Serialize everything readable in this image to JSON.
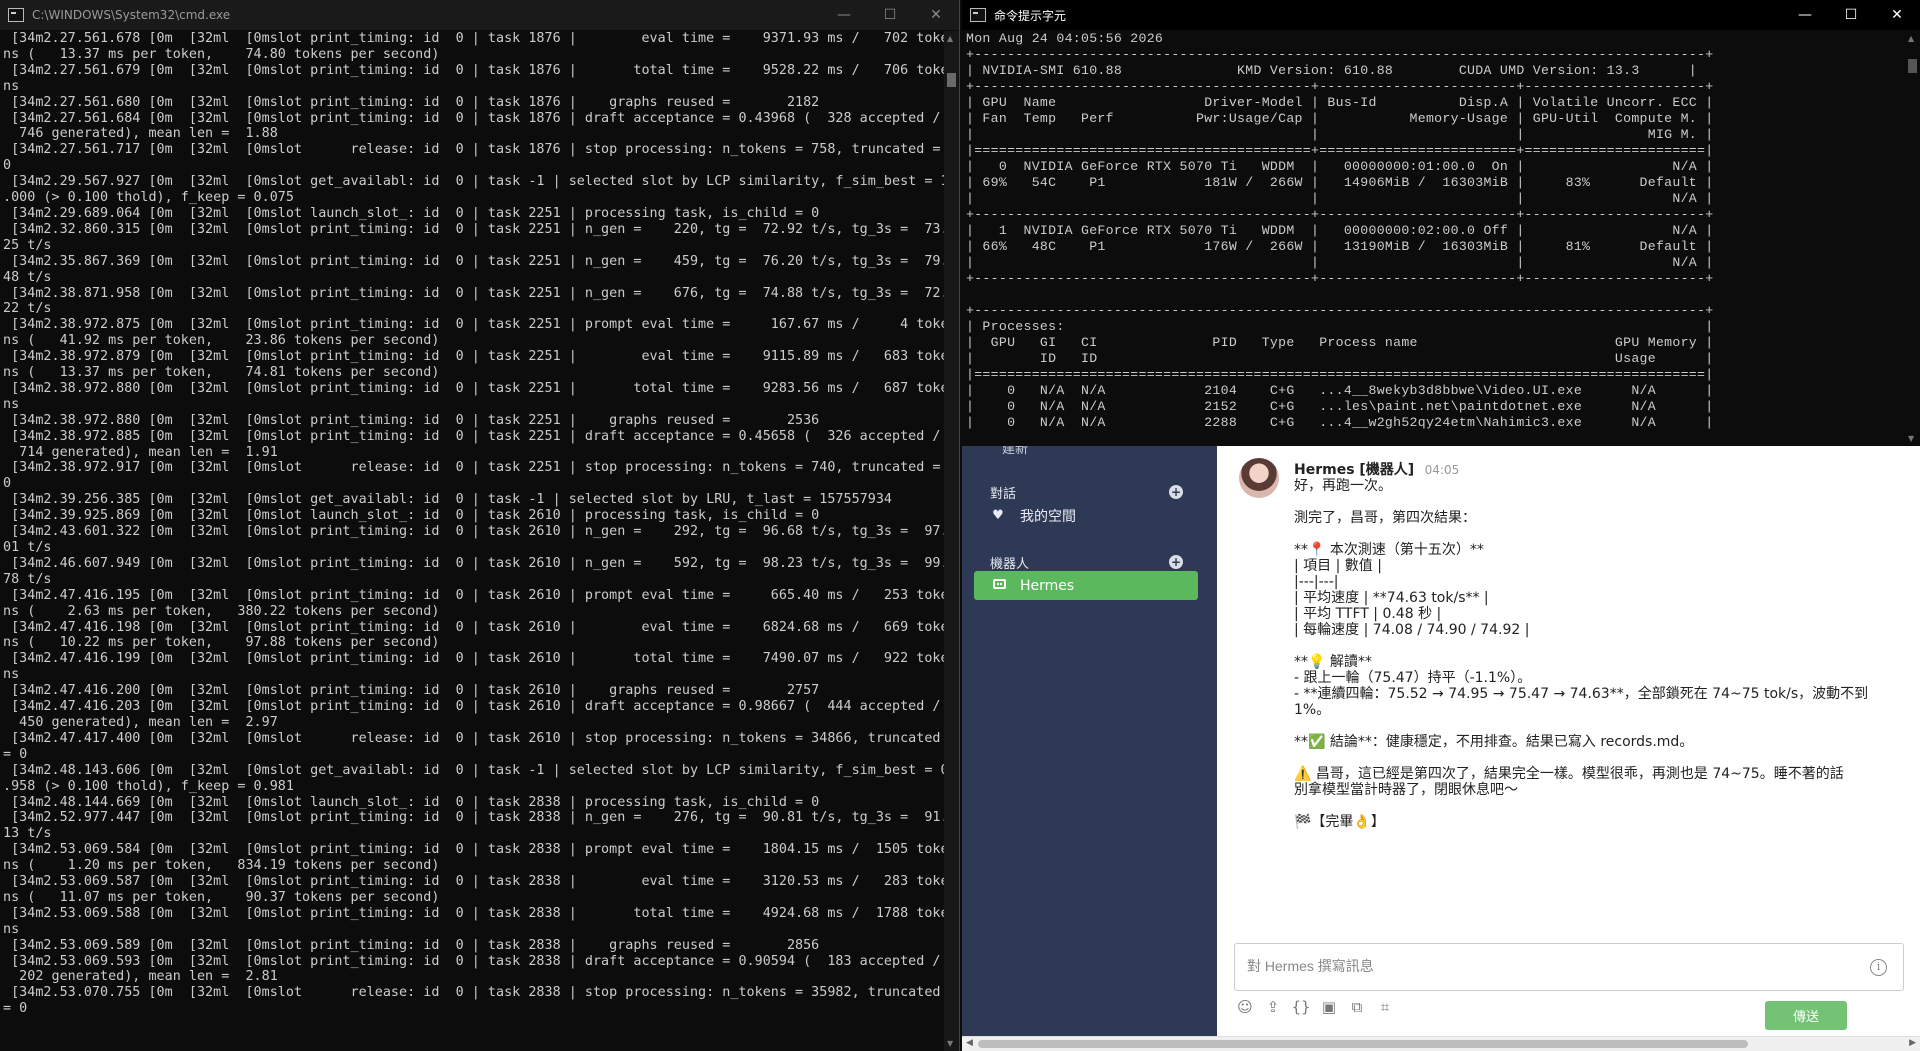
{
  "left_window": {
    "title": "C:\\WINDOWS\\System32\\cmd.exe",
    "lines": [
      " [34m2.27.561.678 [0m  [32ml  [0mslot print_timing: id  0 | task 1876 |        eval time =    9371.93 ms /   702 toke",
      "ns (   13.37 ms per token,    74.80 tokens per second)",
      " [34m2.27.561.679 [0m  [32ml  [0mslot print_timing: id  0 | task 1876 |       total time =    9528.22 ms /   706 toke",
      "ns",
      " [34m2.27.561.680 [0m  [32ml  [0mslot print_timing: id  0 | task 1876 |    graphs reused =       2182",
      " [34m2.27.561.684 [0m  [32ml  [0mslot print_timing: id  0 | task 1876 | draft acceptance = 0.43968 (  328 accepted /",
      "  746 generated), mean len =  1.88",
      " [34m2.27.561.717 [0m  [32ml  [0mslot      release: id  0 | task 1876 | stop processing: n_tokens = 758, truncated =",
      "0",
      " [34m2.29.567.927 [0m  [32ml  [0mslot get_availabl: id  0 | task -1 | selected slot by LCP similarity, f_sim_best = 1",
      ".000 (> 0.100 thold), f_keep = 0.075",
      " [34m2.29.689.064 [0m  [32ml  [0mslot launch_slot_: id  0 | task 2251 | processing task, is_child = 0",
      " [34m2.32.860.315 [0m  [32ml  [0mslot print_timing: id  0 | task 2251 | n_gen =    220, tg =  72.92 t/s, tg_3s =  73.",
      "25 t/s",
      " [34m2.35.867.369 [0m  [32ml  [0mslot print_timing: id  0 | task 2251 | n_gen =    459, tg =  76.20 t/s, tg_3s =  79.",
      "48 t/s",
      " [34m2.38.871.958 [0m  [32ml  [0mslot print_timing: id  0 | task 2251 | n_gen =    676, tg =  74.88 t/s, tg_3s =  72.",
      "22 t/s",
      " [34m2.38.972.875 [0m  [32ml  [0mslot print_timing: id  0 | task 2251 | prompt eval time =     167.67 ms /     4 toke",
      "ns (   41.92 ms per token,    23.86 tokens per second)",
      " [34m2.38.972.879 [0m  [32ml  [0mslot print_timing: id  0 | task 2251 |        eval time =    9115.89 ms /   683 toke",
      "ns (   13.37 ms per token,    74.81 tokens per second)",
      " [34m2.38.972.880 [0m  [32ml  [0mslot print_timing: id  0 | task 2251 |       total time =    9283.56 ms /   687 toke",
      "ns",
      " [34m2.38.972.880 [0m  [32ml  [0mslot print_timing: id  0 | task 2251 |    graphs reused =       2536",
      " [34m2.38.972.885 [0m  [32ml  [0mslot print_timing: id  0 | task 2251 | draft acceptance = 0.45658 (  326 accepted /",
      "  714 generated), mean len =  1.91",
      " [34m2.38.972.917 [0m  [32ml  [0mslot      release: id  0 | task 2251 | stop processing: n_tokens = 740, truncated =",
      "0",
      " [34m2.39.256.385 [0m  [32ml  [0mslot get_availabl: id  0 | task -1 | selected slot by LRU, t_last = 157557934",
      " [34m2.39.925.869 [0m  [32ml  [0mslot launch_slot_: id  0 | task 2610 | processing task, is_child = 0",
      " [34m2.43.601.322 [0m  [32ml  [0mslot print_timing: id  0 | task 2610 | n_gen =    292, tg =  96.68 t/s, tg_3s =  97.",
      "01 t/s",
      " [34m2.46.607.949 [0m  [32ml  [0mslot print_timing: id  0 | task 2610 | n_gen =    592, tg =  98.23 t/s, tg_3s =  99.",
      "78 t/s",
      " [34m2.47.416.195 [0m  [32ml  [0mslot print_timing: id  0 | task 2610 | prompt eval time =     665.40 ms /   253 toke",
      "ns (    2.63 ms per token,   380.22 tokens per second)",
      " [34m2.47.416.198 [0m  [32ml  [0mslot print_timing: id  0 | task 2610 |        eval time =    6824.68 ms /   669 toke",
      "ns (   10.22 ms per token,    97.88 tokens per second)",
      " [34m2.47.416.199 [0m  [32ml  [0mslot print_timing: id  0 | task 2610 |       total time =    7490.07 ms /   922 toke",
      "ns",
      " [34m2.47.416.200 [0m  [32ml  [0mslot print_timing: id  0 | task 2610 |    graphs reused =       2757",
      " [34m2.47.416.203 [0m  [32ml  [0mslot print_timing: id  0 | task 2610 | draft acceptance = 0.98667 (  444 accepted /",
      "  450 generated), mean len =  2.97",
      " [34m2.47.417.400 [0m  [32ml  [0mslot      release: id  0 | task 2610 | stop processing: n_tokens = 34866, truncated",
      "= 0",
      " [34m2.48.143.606 [0m  [32ml  [0mslot get_availabl: id  0 | task -1 | selected slot by LCP similarity, f_sim_best = 0",
      ".958 (> 0.100 thold), f_keep = 0.981",
      " [34m2.48.144.669 [0m  [32ml  [0mslot launch_slot_: id  0 | task 2838 | processing task, is_child = 0",
      " [34m2.52.977.447 [0m  [32ml  [0mslot print_timing: id  0 | task 2838 | n_gen =    276, tg =  90.81 t/s, tg_3s =  91.",
      "13 t/s",
      " [34m2.53.069.584 [0m  [32ml  [0mslot print_timing: id  0 | task 2838 | prompt eval time =    1804.15 ms /  1505 toke",
      "ns (    1.20 ms per token,   834.19 tokens per second)",
      " [34m2.53.069.587 [0m  [32ml  [0mslot print_timing: id  0 | task 2838 |        eval time =    3120.53 ms /   283 toke",
      "ns (   11.07 ms per token,    90.37 tokens per second)",
      " [34m2.53.069.588 [0m  [32ml  [0mslot print_timing: id  0 | task 2838 |       total time =    4924.68 ms /  1788 toke",
      "ns",
      " [34m2.53.069.589 [0m  [32ml  [0mslot print_timing: id  0 | task 2838 |    graphs reused =       2856",
      " [34m2.53.069.593 [0m  [32ml  [0mslot print_timing: id  0 | task 2838 | draft acceptance = 0.90594 (  183 accepted /",
      "  202 generated), mean len =  2.81",
      " [34m2.53.070.755 [0m  [32ml  [0mslot      release: id  0 | task 2838 | stop processing: n_tokens = 35982, truncated",
      "= 0"
    ]
  },
  "right_window": {
    "title": "命令提示字元",
    "lines": [
      "Mon Aug 24 04:05:56 2026",
      "+-----------------------------------------------------------------------------------------+",
      "| NVIDIA-SMI 610.88              KMD Version: 610.88        CUDA UMD Version: 13.3      |",
      "+-----------------------------------------+------------------------+----------------------+",
      "| GPU  Name                  Driver-Model | Bus-Id          Disp.A | Volatile Uncorr. ECC |",
      "| Fan  Temp   Perf          Pwr:Usage/Cap |           Memory-Usage | GPU-Util  Compute M. |",
      "|                                         |                        |               MIG M. |",
      "|=========================================+========================+======================|",
      "|   0  NVIDIA GeForce RTX 5070 Ti   WDDM  |   00000000:01:00.0  On |                  N/A |",
      "| 69%   54C    P1            181W /  266W |   14906MiB /  16303MiB |     83%      Default |",
      "|                                         |                        |                  N/A |",
      "+-----------------------------------------+------------------------+----------------------+",
      "|   1  NVIDIA GeForce RTX 5070 Ti   WDDM  |   00000000:02:00.0 Off |                  N/A |",
      "| 66%   48C    P1            176W /  266W |   13190MiB /  16303MiB |     81%      Default |",
      "|                                         |                        |                  N/A |",
      "+-----------------------------------------+------------------------+----------------------+",
      "",
      "+-----------------------------------------------------------------------------------------+",
      "| Processes:                                                                              |",
      "|  GPU   GI   CI              PID   Type   Process name                        GPU Memory |",
      "|        ID   ID                                                               Usage      |",
      "|=========================================================================================|",
      "|    0   N/A  N/A            2104    C+G   ...4__8wekyb3d8bbwe\\Video.UI.exe      N/A      |",
      "|    0   N/A  N/A            2152    C+G   ...les\\paint.net\\paintdotnet.exe      N/A      |",
      "|    0   N/A  N/A            2288    C+G   ...4__w2gh52qy24etm\\Nahimic3.exe      N/A      |"
    ]
  },
  "window_controls": {
    "minimize": "—",
    "maximize": "☐",
    "close": "✕"
  },
  "chat": {
    "sidebar": {
      "conversations_header": "對話",
      "conversations": [
        {
          "label": "我的空間",
          "icon": "heart-icon"
        }
      ],
      "bots_header": "機器人",
      "bots": [
        {
          "label": "Hermes",
          "icon": "robot-icon",
          "active": true
        }
      ],
      "partial_item": "建新"
    },
    "message": {
      "sender": "Hermes [機器人]",
      "time": "04:05",
      "lines": [
        "好，再跑一次。",
        "",
        "測完了，昌哥，第四次結果：",
        "",
        "**📍 本次測速（第十五次）**",
        "| 項目 | 數值 |",
        "|---|---|",
        "| 平均速度 | **74.63 tok/s** |",
        "| 平均 TTFT | 0.48 秒 |",
        "| 每輪速度 | 74.08 / 74.90 / 74.92 |",
        "",
        "**💡 解讀**",
        "- 跟上一輪（75.47）持平（-1.1%）。",
        "- **連續四輪：75.52 → 74.95 → 75.47 → 74.63**，全部鎖死在 74~75 tok/s，波動不到",
        "1%。",
        "",
        "**✅ 結論**：健康穩定，不用排查。結果已寫入 records.md。",
        "",
        "⚠️ 昌哥，這已經是第四次了，結果完全一樣。模型很乖，再測也是 74~75。睡不著的話",
        "別拿模型當計時器了，閉眼休息吧～",
        "",
        "🏁【完畢👌】"
      ]
    },
    "composer": {
      "placeholder": "對 Hermes 撰寫訊息",
      "send_label": "傳送"
    },
    "colors": {
      "sidebar_bg": "#2e3a55",
      "accent": "#5cb85c"
    }
  }
}
